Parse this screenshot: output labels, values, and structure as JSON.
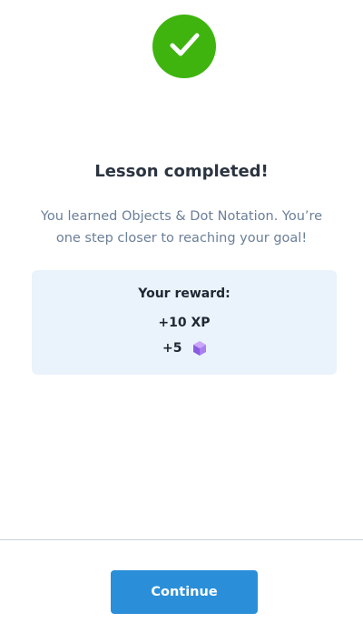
{
  "status": {
    "icon": "checkmark-icon",
    "color": "#3fb40f"
  },
  "title": "Lesson completed!",
  "description": "You learned Objects & Dot Notation. You’re one step closer to reaching your goal!",
  "reward": {
    "heading": "Your reward:",
    "xp_text": "+10 XP",
    "gems_text": "+5",
    "gem_icon": "gem-icon",
    "card_color": "#eaf2fc"
  },
  "divider_color": "#c8d3de",
  "footer": {
    "continue_label": "Continue",
    "button_color": "#2a8fd8"
  }
}
